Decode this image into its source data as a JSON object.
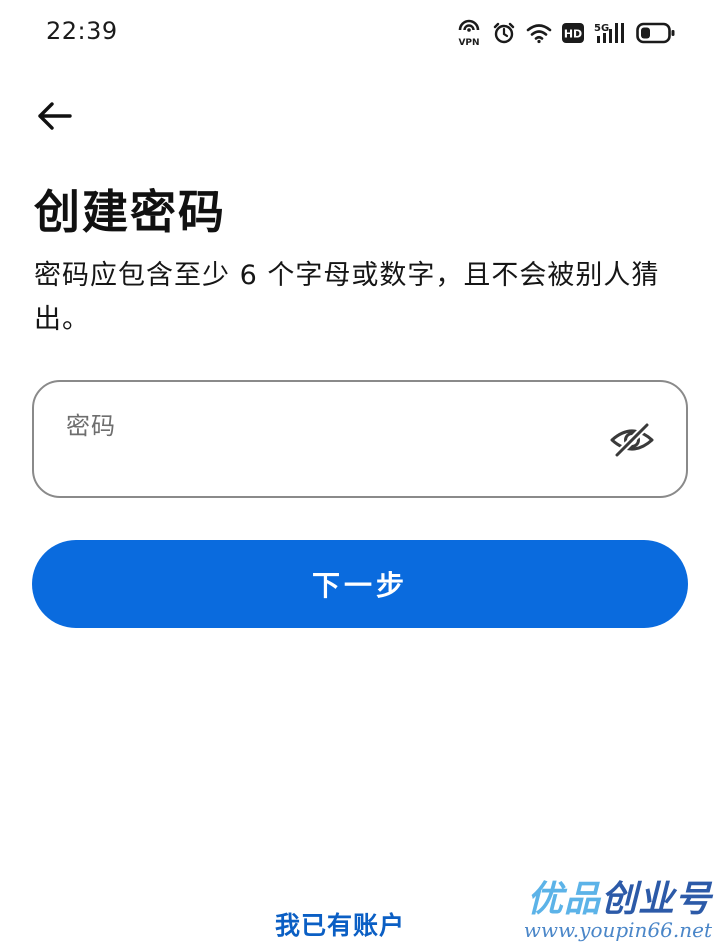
{
  "status_bar": {
    "time": "22:39",
    "icons": [
      "vpn-icon",
      "alarm-icon",
      "wifi-icon",
      "hd-icon",
      "signal-5g-icon",
      "battery-icon"
    ],
    "vpn_label": "VPN",
    "hd_label": "HD",
    "network_label": "5G"
  },
  "header": {
    "back_icon": "arrow-left-icon"
  },
  "main": {
    "title": "创建密码",
    "description": "密码应包含至少 6 个字母或数字，且不会被别人猜出。",
    "password_field": {
      "label": "密码",
      "value": "",
      "toggle_icon": "eye-off-icon"
    },
    "next_button_label": "下一步"
  },
  "footer": {
    "login_link": "我已有账户"
  },
  "watermark": {
    "brand_part1": "优品",
    "brand_part2": "创业号",
    "url": "www.youpin66.net"
  },
  "colors": {
    "accent": "#0a6bde",
    "link": "#0b5fc4",
    "field_border": "#8a8a8a"
  }
}
